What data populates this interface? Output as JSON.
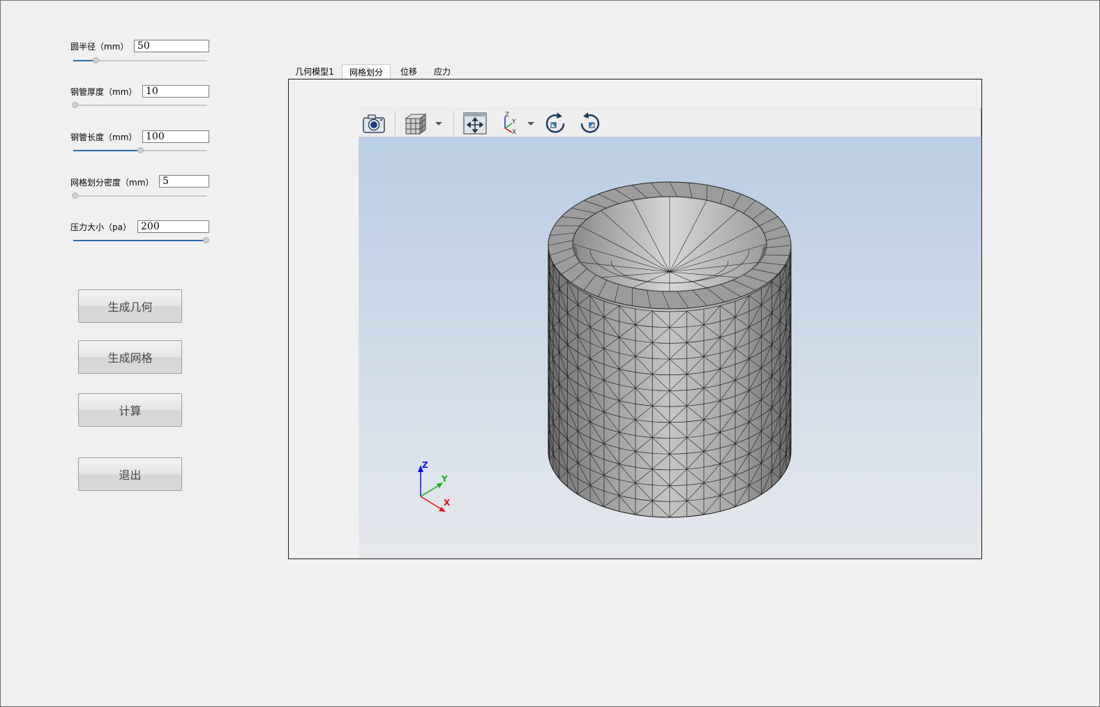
{
  "params": [
    {
      "label": "圆半径（mm）",
      "value": "50",
      "slider_fraction": 0.16
    },
    {
      "label": "钢管厚度（mm）",
      "value": "10",
      "slider_fraction": 0.0
    },
    {
      "label": "钢管长度（mm）",
      "value": "100",
      "slider_fraction": 0.5
    },
    {
      "label": "网格划分密度（mm）",
      "value": "5",
      "slider_fraction": 0.0
    },
    {
      "label": "压力大小（pa）",
      "value": "200",
      "slider_fraction": 1.0
    }
  ],
  "buttons": {
    "generate_geometry": "生成几何",
    "generate_mesh": "生成网格",
    "compute": "计算",
    "exit": "退出"
  },
  "tabs": [
    {
      "label": "几何模型1",
      "active": false
    },
    {
      "label": "网格划分",
      "active": true
    },
    {
      "label": "位移",
      "active": false
    },
    {
      "label": "应力",
      "active": false
    }
  ],
  "toolbar": {
    "icons": [
      "camera-icon",
      "view-cube-icon",
      "dropdown-arrow-icon",
      "fit-all-icon",
      "axis-triad-icon",
      "dropdown-arrow-icon",
      "rotate-cw-icon",
      "rotate-ccw-icon"
    ]
  },
  "axis_triad": {
    "x": "X",
    "y": "Y",
    "z": "Z"
  },
  "colors": {
    "window_bg": "#f0f0f0",
    "slider_fill": "#2b6cb0",
    "viewport_top": "#b9cde4",
    "viewport_bottom": "#e6e8ec",
    "mesh_face": "#c4c4c4",
    "axis_x": "#e01010",
    "axis_y": "#10b010",
    "axis_z": "#1010e0"
  }
}
